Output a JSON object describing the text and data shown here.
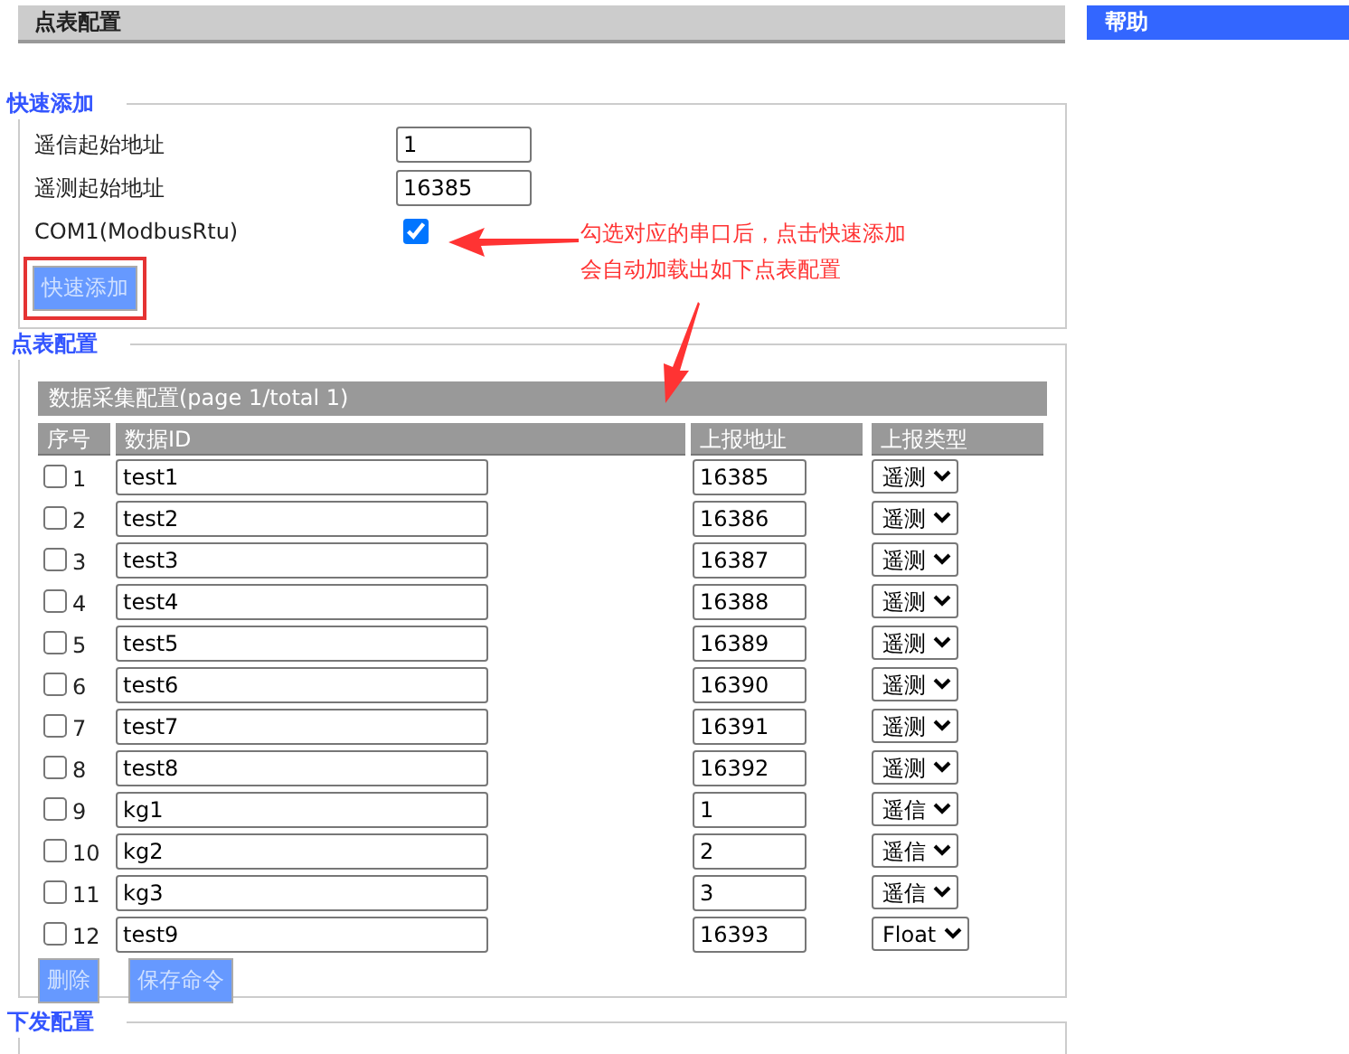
{
  "header": {
    "title": "点表配置"
  },
  "help": {
    "title": "帮助"
  },
  "quick_add": {
    "legend": "快速添加",
    "fields": [
      {
        "label": "遥信起始地址",
        "value": "1"
      },
      {
        "label": "遥测起始地址",
        "value": "16385"
      }
    ],
    "port": {
      "label": "COM1(ModbusRtu)",
      "checked": true
    },
    "button": "快速添加"
  },
  "annotation": {
    "lines": [
      "勾选对应的串口后，点击快速添加",
      "会自动加载出如下点表配置"
    ]
  },
  "point_table": {
    "legend": "点表配置",
    "caption": "数据采集配置(page 1/total 1)",
    "columns": [
      "序号",
      "数据ID",
      "上报地址",
      "上报类型"
    ],
    "rows": [
      {
        "index": "1",
        "checked": false,
        "id": "test1",
        "address": "16385",
        "type": "遥测"
      },
      {
        "index": "2",
        "checked": false,
        "id": "test2",
        "address": "16386",
        "type": "遥测"
      },
      {
        "index": "3",
        "checked": false,
        "id": "test3",
        "address": "16387",
        "type": "遥测"
      },
      {
        "index": "4",
        "checked": false,
        "id": "test4",
        "address": "16388",
        "type": "遥测"
      },
      {
        "index": "5",
        "checked": false,
        "id": "test5",
        "address": "16389",
        "type": "遥测"
      },
      {
        "index": "6",
        "checked": false,
        "id": "test6",
        "address": "16390",
        "type": "遥测"
      },
      {
        "index": "7",
        "checked": false,
        "id": "test7",
        "address": "16391",
        "type": "遥测"
      },
      {
        "index": "8",
        "checked": false,
        "id": "test8",
        "address": "16392",
        "type": "遥测"
      },
      {
        "index": "9",
        "checked": false,
        "id": "kg1",
        "address": "1",
        "type": "遥信"
      },
      {
        "index": "10",
        "checked": false,
        "id": "kg2",
        "address": "2",
        "type": "遥信"
      },
      {
        "index": "11",
        "checked": false,
        "id": "kg3",
        "address": "3",
        "type": "遥信"
      },
      {
        "index": "12",
        "checked": false,
        "id": "test9",
        "address": "16393",
        "type": "Float"
      }
    ],
    "buttons": [
      "删除",
      "保存命令"
    ]
  },
  "dispatch": {
    "legend": "下发配置"
  }
}
